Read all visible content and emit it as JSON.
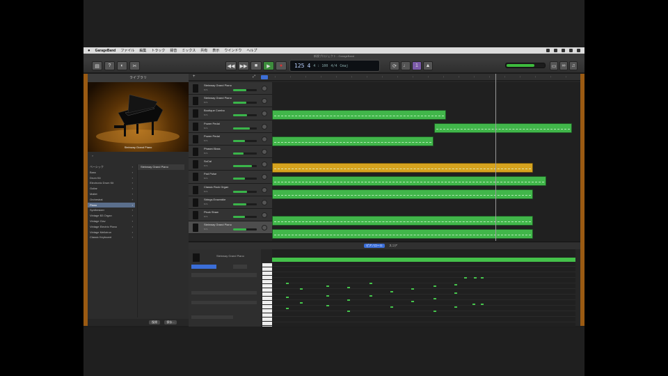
{
  "menubar": {
    "app_name": "GarageBand",
    "items": [
      "ファイル",
      "編集",
      "トラック",
      "録音",
      "ミックス",
      "共有",
      "表示",
      "ウインドウ",
      "ヘルプ"
    ]
  },
  "window": {
    "title": "新規プロジェクト - GarageBand"
  },
  "lcd": {
    "bar": "125",
    "beat": "4",
    "tempo": "4 : 100",
    "signature": "4/4",
    "key": "Cmaj"
  },
  "library": {
    "header": "ライブラリ",
    "selected_patch": "Steinway Grand Piano",
    "categories": [
      {
        "label": "ベーシック",
        "selected": false
      },
      {
        "label": "Bass",
        "selected": false
      },
      {
        "label": "Drum Kit",
        "selected": false
      },
      {
        "label": "Electronic Drum Kit",
        "selected": false
      },
      {
        "label": "Guitar",
        "selected": false
      },
      {
        "label": "Mallet",
        "selected": false
      },
      {
        "label": "Orchestral",
        "selected": false
      },
      {
        "label": "Piano",
        "selected": true
      },
      {
        "label": "Synthesizer",
        "selected": false
      },
      {
        "label": "Vintage B3 Organ",
        "selected": false
      },
      {
        "label": "Vintage Clav",
        "selected": false
      },
      {
        "label": "Vintage Electric Piano",
        "selected": false
      },
      {
        "label": "Vintage Mellotron",
        "selected": false
      },
      {
        "label": "Classic Keyboard",
        "selected": false
      }
    ],
    "patches": [
      "Steinway Grand Piano"
    ],
    "footer": {
      "revert_label": "復帰",
      "save_label": "保存..."
    }
  },
  "tracks": [
    {
      "name": "Steinway Grand Piano",
      "vol": 0.55,
      "selected": false
    },
    {
      "name": "Steinway Grand Piano",
      "vol": 0.55,
      "selected": false
    },
    {
      "name": "Boutique Combo",
      "vol": 0.6,
      "selected": false
    },
    {
      "name": "Power Pedal",
      "vol": 0.7,
      "selected": false
    },
    {
      "name": "Power Pedal",
      "vol": 0.5,
      "selected": false
    },
    {
      "name": "Phased Bass",
      "vol": 0.45,
      "selected": false
    },
    {
      "name": "SoCal",
      "vol": 0.8,
      "selected": false
    },
    {
      "name": "Pad Pulse",
      "vol": 0.5,
      "selected": false
    },
    {
      "name": "Classic Rock Organ",
      "vol": 0.6,
      "selected": false
    },
    {
      "name": "Strings Ensemble",
      "vol": 0.55,
      "selected": false
    },
    {
      "name": "Pluck Shaw",
      "vol": 0.5,
      "selected": false
    },
    {
      "name": "Steinway Grand Piano",
      "vol": 0.55,
      "selected": true
    }
  ],
  "editor": {
    "tabs": [
      "ピアノロール",
      "スコア"
    ],
    "track_label": "Steinway Grand Piano",
    "region_label": "Steinway Grand Piano"
  },
  "colors": {
    "midi_region": "#41b64a",
    "drum_region": "#d6a31e",
    "selection": "#5b6f8c",
    "accent_orange": "#9a5a12"
  }
}
